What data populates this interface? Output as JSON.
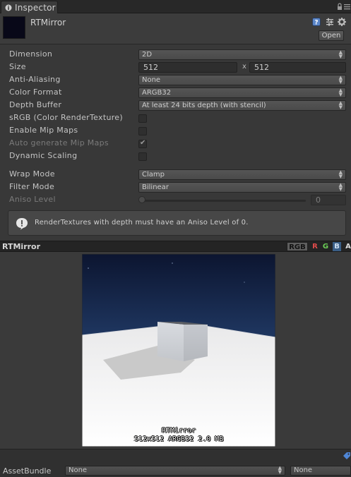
{
  "window": {
    "tab_label": "Inspector"
  },
  "header": {
    "asset_name": "RTMirror",
    "open_label": "Open"
  },
  "properties": {
    "dimension": {
      "label": "Dimension",
      "value": "2D"
    },
    "size": {
      "label": "Size",
      "width": "512",
      "x_sep": "x",
      "height": "512"
    },
    "anti_aliasing": {
      "label": "Anti-Aliasing",
      "value": "None"
    },
    "color_format": {
      "label": "Color Format",
      "value": "ARGB32"
    },
    "depth_buffer": {
      "label": "Depth Buffer",
      "value": "At least 24 bits depth (with stencil)"
    },
    "srgb": {
      "label": "sRGB (Color RenderTexture)",
      "checked": false
    },
    "enable_mip_maps": {
      "label": "Enable Mip Maps",
      "checked": false
    },
    "auto_generate_mip_maps": {
      "label": "Auto generate Mip Maps",
      "checked": true,
      "enabled": false
    },
    "dynamic_scaling": {
      "label": "Dynamic Scaling",
      "checked": false
    },
    "wrap_mode": {
      "label": "Wrap Mode",
      "value": "Clamp"
    },
    "filter_mode": {
      "label": "Filter Mode",
      "value": "Bilinear"
    },
    "aniso_level": {
      "label": "Aniso Level",
      "value": "0",
      "enabled": false
    }
  },
  "help": {
    "message": "RenderTextures with depth must have an Aniso Level of 0."
  },
  "preview": {
    "title": "RTMirror",
    "channels": {
      "rgb": "RGB",
      "r": "R",
      "g": "G",
      "b": "B",
      "a": "A"
    },
    "overlay_name": "RTMirror",
    "overlay_info": "512x512  ARGB32  2.0 MB"
  },
  "asset_bundle": {
    "label": "AssetBundle",
    "name_value": "None",
    "variant_value": "None"
  },
  "colors": {
    "background": "#383838",
    "sky_top": "#0c1530",
    "sky_bottom": "#3d5f91",
    "ground": "#f0f0f0"
  },
  "icons": [
    "inspector-icon",
    "lock-icon",
    "menu-icon",
    "help-icon",
    "preset-icon",
    "gear-icon",
    "info-icon",
    "tag-icon"
  ]
}
